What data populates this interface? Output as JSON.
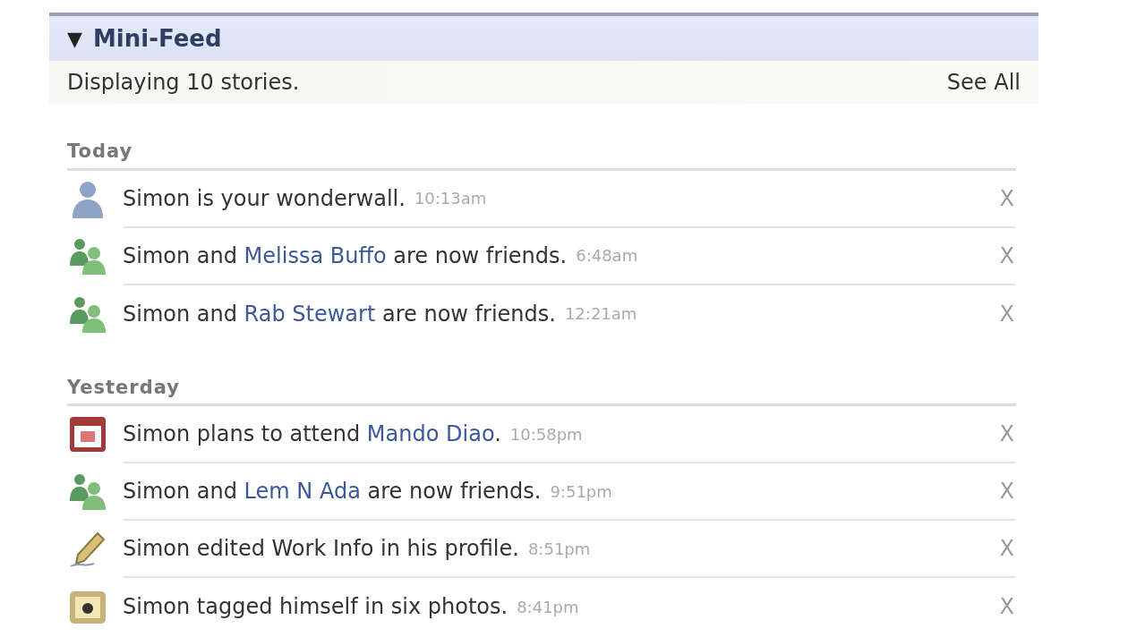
{
  "panel": {
    "title": "Mini-Feed",
    "toggle": "▼",
    "summary": "Displaying 10 stories.",
    "see_all": "See All"
  },
  "sections": [
    {
      "heading": "Today",
      "stories": [
        {
          "kind": "person",
          "parts": [
            {
              "kind": "text",
              "text": "Simon is your wonderwall."
            }
          ],
          "time": "10:13am",
          "close": "X"
        },
        {
          "kind": "friends",
          "parts": [
            {
              "kind": "text",
              "text": "Simon and "
            },
            {
              "kind": "link",
              "text": "Melissa Buffo"
            },
            {
              "kind": "text",
              "text": " are now friends."
            }
          ],
          "time": "6:48am",
          "close": "X"
        },
        {
          "kind": "friends",
          "parts": [
            {
              "kind": "text",
              "text": "Simon and "
            },
            {
              "kind": "link",
              "text": "Rab Stewart"
            },
            {
              "kind": "text",
              "text": " are now friends."
            }
          ],
          "time": "12:21am",
          "close": "X"
        }
      ]
    },
    {
      "heading": "Yesterday",
      "stories": [
        {
          "kind": "event",
          "parts": [
            {
              "kind": "text",
              "text": "Simon plans to attend "
            },
            {
              "kind": "link",
              "text": "Mando Diao"
            },
            {
              "kind": "text",
              "text": "."
            }
          ],
          "time": "10:58pm",
          "close": "X"
        },
        {
          "kind": "friends",
          "parts": [
            {
              "kind": "text",
              "text": "Simon and "
            },
            {
              "kind": "link",
              "text": "Lem N Ada"
            },
            {
              "kind": "text",
              "text": " are now friends."
            }
          ],
          "time": "9:51pm",
          "close": "X"
        },
        {
          "kind": "edit",
          "parts": [
            {
              "kind": "text",
              "text": "Simon edited Work Info in his profile."
            }
          ],
          "time": "8:51pm",
          "close": "X"
        },
        {
          "kind": "photo",
          "parts": [
            {
              "kind": "text",
              "text": "Simon tagged himself in six photos."
            }
          ],
          "time": "8:41pm",
          "close": "X"
        }
      ]
    }
  ]
}
